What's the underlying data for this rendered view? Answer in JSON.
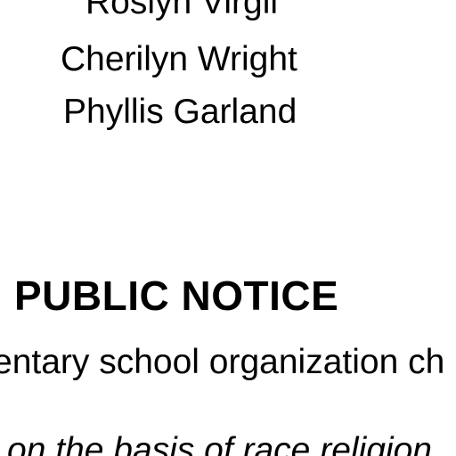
{
  "names": [
    "Roslyn Virgil",
    "Cherilyn Wright",
    "Phyllis Garland"
  ],
  "notice": {
    "heading": "PUBLIC NOTICE",
    "body_fragment": "entary school organization ch",
    "partial_fragment": "on the basis of race religion"
  }
}
